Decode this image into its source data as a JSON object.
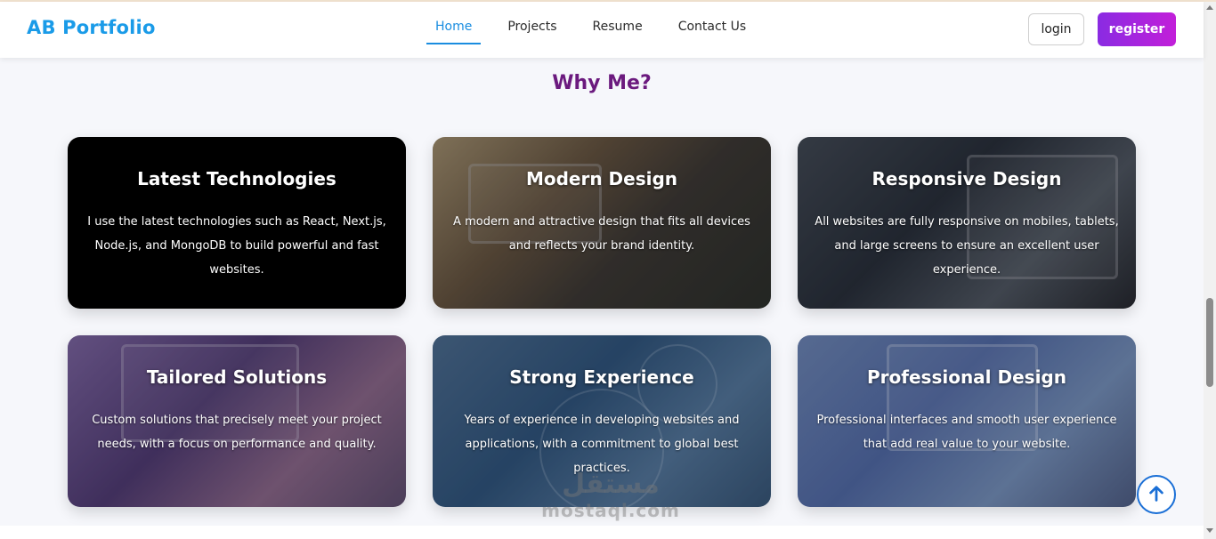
{
  "header": {
    "logo": "AB Portfolio",
    "nav": [
      {
        "label": "Home",
        "active": true
      },
      {
        "label": "Projects",
        "active": false
      },
      {
        "label": "Resume",
        "active": false
      },
      {
        "label": "Contact Us",
        "active": false
      }
    ],
    "login_label": "login",
    "register_label": "register"
  },
  "section": {
    "title": "Why Me?"
  },
  "cards": [
    {
      "title": "Latest Technologies",
      "text": "I use the latest technologies such as React, Next.js, Node.js, and MongoDB to build powerful and fast websites."
    },
    {
      "title": "Modern Design",
      "text": "A modern and attractive design that fits all devices and reflects your brand identity."
    },
    {
      "title": "Responsive Design",
      "text": "All websites are fully responsive on mobiles, tablets, and large screens to ensure an excellent user experience."
    },
    {
      "title": "Tailored Solutions",
      "text": "Custom solutions that precisely meet your project needs, with a focus on performance and quality."
    },
    {
      "title": "Strong Experience",
      "text": "Years of experience in developing websites and applications, with a commitment to global best practices."
    },
    {
      "title": "Professional Design",
      "text": "Professional interfaces and smooth user experience that add real value to your website."
    }
  ],
  "watermark": {
    "arabic": "مستقل",
    "latin": "mostaql.com"
  },
  "colors": {
    "brand": "#1a9be8",
    "title": "#6b1a7e",
    "register_gradient_start": "#8a2be2",
    "register_gradient_end": "#c21fd9",
    "active_nav": "#1a8de0"
  },
  "icons": {
    "scroll_top": "arrow-up-icon"
  }
}
